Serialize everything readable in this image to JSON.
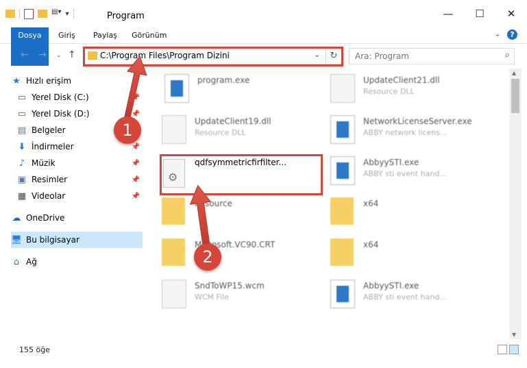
{
  "window": {
    "title": "Program",
    "minimize": "—",
    "maximize": "☐",
    "close": "✕"
  },
  "ribbon": {
    "tabs": [
      "Dosya",
      "Giriş",
      "Paylaş",
      "Görünüm"
    ],
    "help": "?"
  },
  "address": {
    "path": "C:\\Program Files\\Program Dizini"
  },
  "search": {
    "placeholder": "Ara: Program"
  },
  "nav": {
    "items": [
      {
        "label": "Hızlı erişim",
        "icon": "star-icon"
      },
      {
        "label": "Yerel Disk (C:)",
        "icon": "drive-icon",
        "pinned": true
      },
      {
        "label": "Yerel Disk (D:)",
        "icon": "drive-icon",
        "pinned": true
      },
      {
        "label": "Belgeler",
        "icon": "documents-icon",
        "pinned": true
      },
      {
        "label": "İndirmeler",
        "icon": "download-icon",
        "pinned": true
      },
      {
        "label": "Müzik",
        "icon": "music-icon",
        "pinned": true
      },
      {
        "label": "Resimler",
        "icon": "pictures-icon",
        "pinned": true
      },
      {
        "label": "Videolar",
        "icon": "videos-icon",
        "pinned": true
      },
      {
        "label": "OneDrive",
        "icon": "cloud-icon"
      },
      {
        "label": "Bu bilgisayar",
        "icon": "computer-icon",
        "selected": true
      },
      {
        "label": "Ağ",
        "icon": "network-icon"
      }
    ]
  },
  "files": [
    {
      "name": "program.exe",
      "desc": ""
    },
    {
      "name": "UpdateClient21.dll",
      "desc": "Resource DLL"
    },
    {
      "name": "UpdateClient19.dll",
      "desc": "Resource DLL"
    },
    {
      "name": "NetworkLicenseServer.exe",
      "desc": "ABBY network licens..."
    },
    {
      "name": "qdfsymmetricfirfilter...",
      "desc": ""
    },
    {
      "name": "AbbyySTI.exe",
      "desc": "ABBY sti event hand..."
    },
    {
      "name": "Resource",
      "desc": ""
    },
    {
      "name": "x64",
      "desc": ""
    },
    {
      "name": "Microsoft.VC90.CRT",
      "desc": ""
    },
    {
      "name": "x64",
      "desc": ""
    },
    {
      "name": "SndToWP15.wcm",
      "desc": "WCM File"
    },
    {
      "name": "AbbyySTI.exe",
      "desc": "ABBY sti event hand..."
    }
  ],
  "annotations": {
    "step1": "1",
    "step2": "2",
    "color": "#d6453a"
  },
  "status": {
    "count": "155 öğe"
  }
}
